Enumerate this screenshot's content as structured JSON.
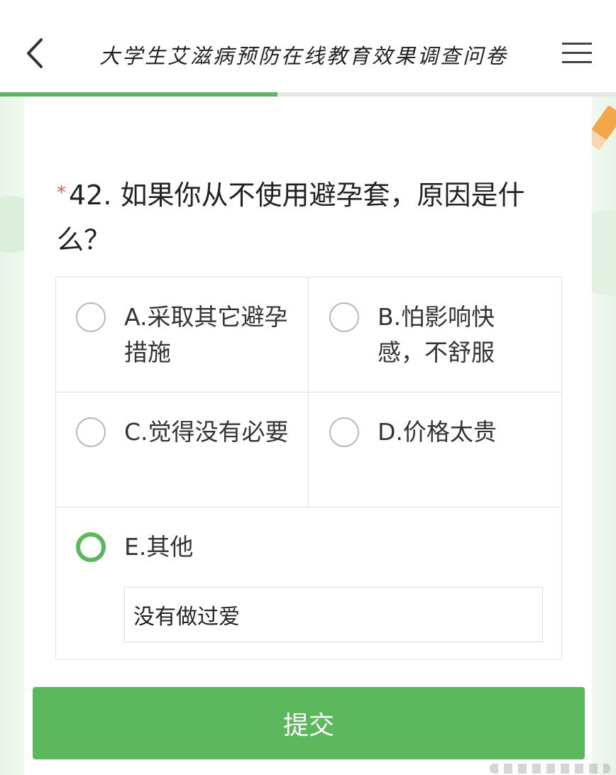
{
  "header": {
    "title": "大学生艾滋病预防在线教育效果调查问卷",
    "back_icon": "chevron-left-icon",
    "menu_icon": "hamburger-menu-icon"
  },
  "progress": {
    "value": 0.45,
    "color": "#5cb85c"
  },
  "question": {
    "required_mark": "*",
    "text": "42. 如果你从不使用避孕套，原因是什么？"
  },
  "options": [
    {
      "label": "A.采取其它避孕措施",
      "checked": false
    },
    {
      "label": "B.怕影响快感，不舒服",
      "checked": false
    },
    {
      "label": "C.觉得没有必要",
      "checked": false
    },
    {
      "label": "D.价格太贵",
      "checked": false
    },
    {
      "label": "E.其他",
      "checked": true
    }
  ],
  "other_input": {
    "value": "没有做过爱"
  },
  "submit": {
    "label": "提交"
  },
  "colors": {
    "accent": "#5cb85c",
    "required": "#e05a4a"
  }
}
